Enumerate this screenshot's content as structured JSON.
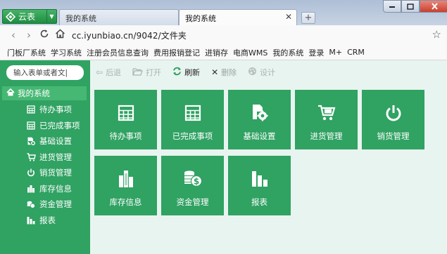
{
  "browser": {
    "app_button": "云表",
    "tabs": [
      {
        "title": "我的系统",
        "active": false
      },
      {
        "title": "我的系统",
        "active": true
      }
    ],
    "new_tab_symbol": "+",
    "url": "cc.iyunbiao.cn/9042/文件夹",
    "bookmarks": [
      "门板厂系统",
      "学习系统",
      "注册会员信息查询",
      "费用报销登记",
      "进销存",
      "电商WMS",
      "我的系统",
      "登录",
      "M+",
      "CRM"
    ]
  },
  "sidebar": {
    "search_placeholder": "输入表单或者文|",
    "root": "我的系统",
    "items": [
      {
        "label": "待办事项",
        "icon": "table-icon"
      },
      {
        "label": "已完成事项",
        "icon": "table-icon"
      },
      {
        "label": "基础设置",
        "icon": "gear-doc-icon"
      },
      {
        "label": "进货管理",
        "icon": "cart-icon"
      },
      {
        "label": "销货管理",
        "icon": "power-icon"
      },
      {
        "label": "库存信息",
        "icon": "building-icon"
      },
      {
        "label": "资金管理",
        "icon": "coins-icon"
      },
      {
        "label": "报表",
        "icon": "bar-chart-icon"
      }
    ]
  },
  "toolbar": {
    "back": "后退",
    "open": "打开",
    "refresh": "刷新",
    "delete": "删除",
    "design": "设计"
  },
  "tiles": [
    {
      "label": "待办事项",
      "icon": "table-icon"
    },
    {
      "label": "已完成事项",
      "icon": "table-icon"
    },
    {
      "label": "基础设置",
      "icon": "gear-doc-icon"
    },
    {
      "label": "进货管理",
      "icon": "cart-icon"
    },
    {
      "label": "销货管理",
      "icon": "power-icon"
    },
    {
      "label": "库存信息",
      "icon": "building-icon"
    },
    {
      "label": "资金管理",
      "icon": "coins-icon"
    },
    {
      "label": "报表",
      "icon": "bar-chart-icon"
    }
  ],
  "colors": {
    "accent_green": "#30a262",
    "active_green": "#47b874",
    "content_bg": "#e8f4ef"
  }
}
